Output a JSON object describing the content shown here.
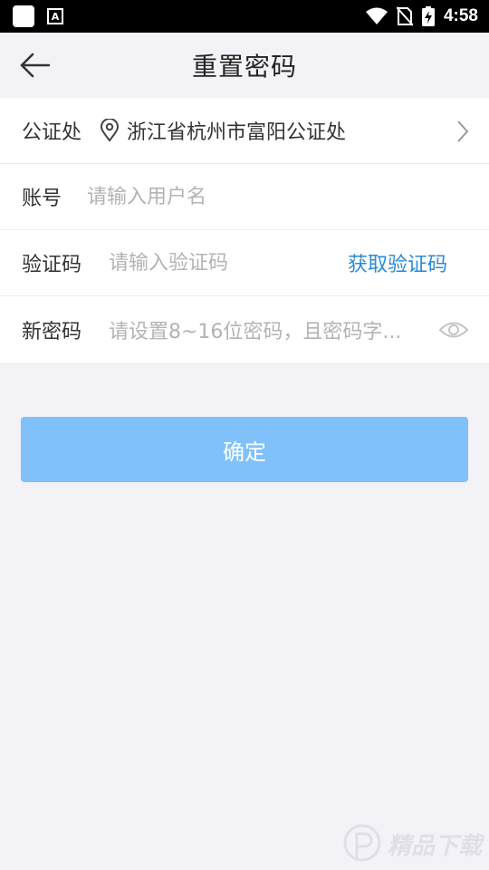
{
  "status_bar": {
    "time": "4:58",
    "icons": [
      "app-square-icon",
      "font-a-icon",
      "wifi-icon",
      "no-sim-icon",
      "battery-charging-icon"
    ],
    "app_icon_letter": "A"
  },
  "header": {
    "title": "重置密码",
    "back_icon": "back-arrow-icon"
  },
  "form": {
    "notary": {
      "label": "公证处",
      "value": "浙江省杭州市富阳公证处",
      "icon": "location-pin-icon"
    },
    "account": {
      "label": "账号",
      "placeholder": "请输入用户名",
      "value": ""
    },
    "code": {
      "label": "验证码",
      "placeholder": "请输入验证码",
      "value": "",
      "action_label": "获取验证码"
    },
    "password": {
      "label": "新密码",
      "placeholder": "请设置8~16位密码，且密码字...",
      "value": ""
    }
  },
  "confirm_label": "确定",
  "watermark": "精品下载",
  "colors": {
    "background": "#f2f2f7",
    "accent": "#2a8ad8",
    "button": "#80c1fb"
  }
}
